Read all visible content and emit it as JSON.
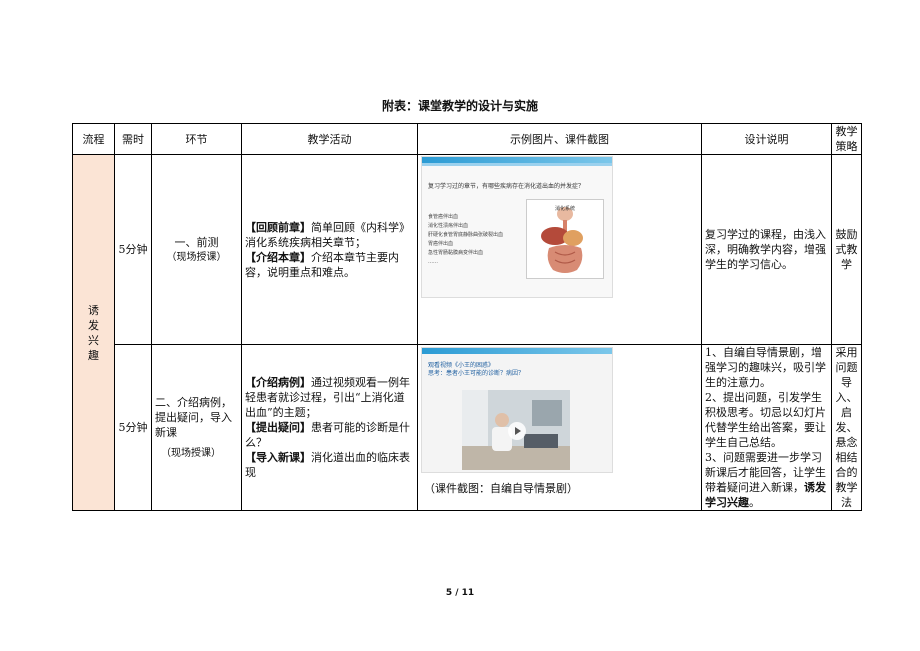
{
  "title": "附表：课堂教学的设计与实施",
  "headers": {
    "flow": "流程",
    "time": "需时",
    "step": "环节",
    "activity": "教学活动",
    "example": "示例图片、课件截图",
    "design": "设计说明",
    "strategy": "教学策略"
  },
  "flow_label": "诱发兴趣",
  "rows": [
    {
      "time": "5分钟",
      "step_title": "一、前测",
      "step_note": "（现场授课）",
      "activities": [
        {
          "tag": "【回顾前章】",
          "text": "简单回顾《内科学》消化系统疾病相关章节；"
        },
        {
          "tag": "【介绍本章】",
          "text": "介绍本章节主要内容，说明重点和难点。"
        }
      ],
      "slide": {
        "question": "复习学习过的章节，有哪些疾病存在消化道出血的并发症？",
        "list": [
          "食管癌伴出血",
          "消化性溃疡伴出血",
          "肝硬化食管胃底静脉曲张破裂出血",
          "胃癌伴出血",
          "急性胃肠黏膜病变伴出血",
          "……"
        ],
        "image_title": "消化系统"
      },
      "design": "复习学过的课程，由浅入深，明确教学内容，增强学生的学习信心。",
      "strategy": "鼓励式教学"
    },
    {
      "time": "5分钟",
      "step_title": "二、介绍病例，提出疑问，导入新课",
      "step_note": "（现场授课）",
      "activities": [
        {
          "tag": "【介绍病例】",
          "text": "通过视频观看一例年轻患者就诊过程，引出“上消化道出血”的主题；"
        },
        {
          "tag": "【提出疑问】",
          "text": "患者可能的诊断是什么？"
        },
        {
          "tag": "【导入新课】",
          "text": "消化道出血的临床表现"
        }
      ],
      "slide": {
        "line1": "观看视频《小王的困惑》",
        "line2": "思考：患者小王可能的诊断？病因？"
      },
      "caption": "（课件截图：自编自导情景剧）",
      "design_parts": [
        "1、自编自导情景剧，增强学习的趣味兴，吸引学生的注意力。",
        "2、提出问题，引发学生积极思考。切忌以幻灯片代替学生给出答案，要让学生自己总结。",
        "3、问题需要进一步学习新课后才能回答，让学生带着疑问进入新课，"
      ],
      "design_bold": "诱发学习兴趣",
      "design_end": "。",
      "strategy": "采用问题导入、启发、悬念相结合的教学法"
    }
  ],
  "page": "5 / 11",
  "colors": {
    "flow_bg": "#fbe4d5",
    "slide_bar": "#2b9bd4"
  }
}
